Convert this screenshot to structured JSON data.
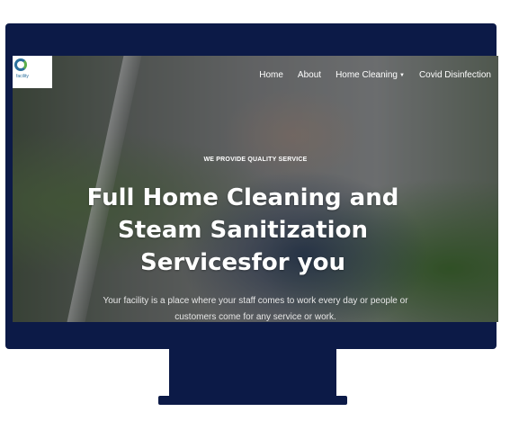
{
  "logo": {
    "name": "facility"
  },
  "nav": {
    "items": [
      {
        "label": "Home"
      },
      {
        "label": "About"
      },
      {
        "label": "Home Cleaning",
        "has_dropdown": true
      },
      {
        "label": "Covid Disinfection"
      }
    ]
  },
  "hero": {
    "tagline": "WE PROVIDE QUALITY SERVICE",
    "headline_lines": [
      "Full Home Cleaning and",
      "Steam Sanitization",
      "Servicesfor you"
    ],
    "subtext_lines": [
      "Your facility is a place where your staff comes to work every day or people or",
      "customers come for any service or work."
    ]
  },
  "colors": {
    "monitor": "#0c1a47",
    "text": "#ffffff"
  }
}
